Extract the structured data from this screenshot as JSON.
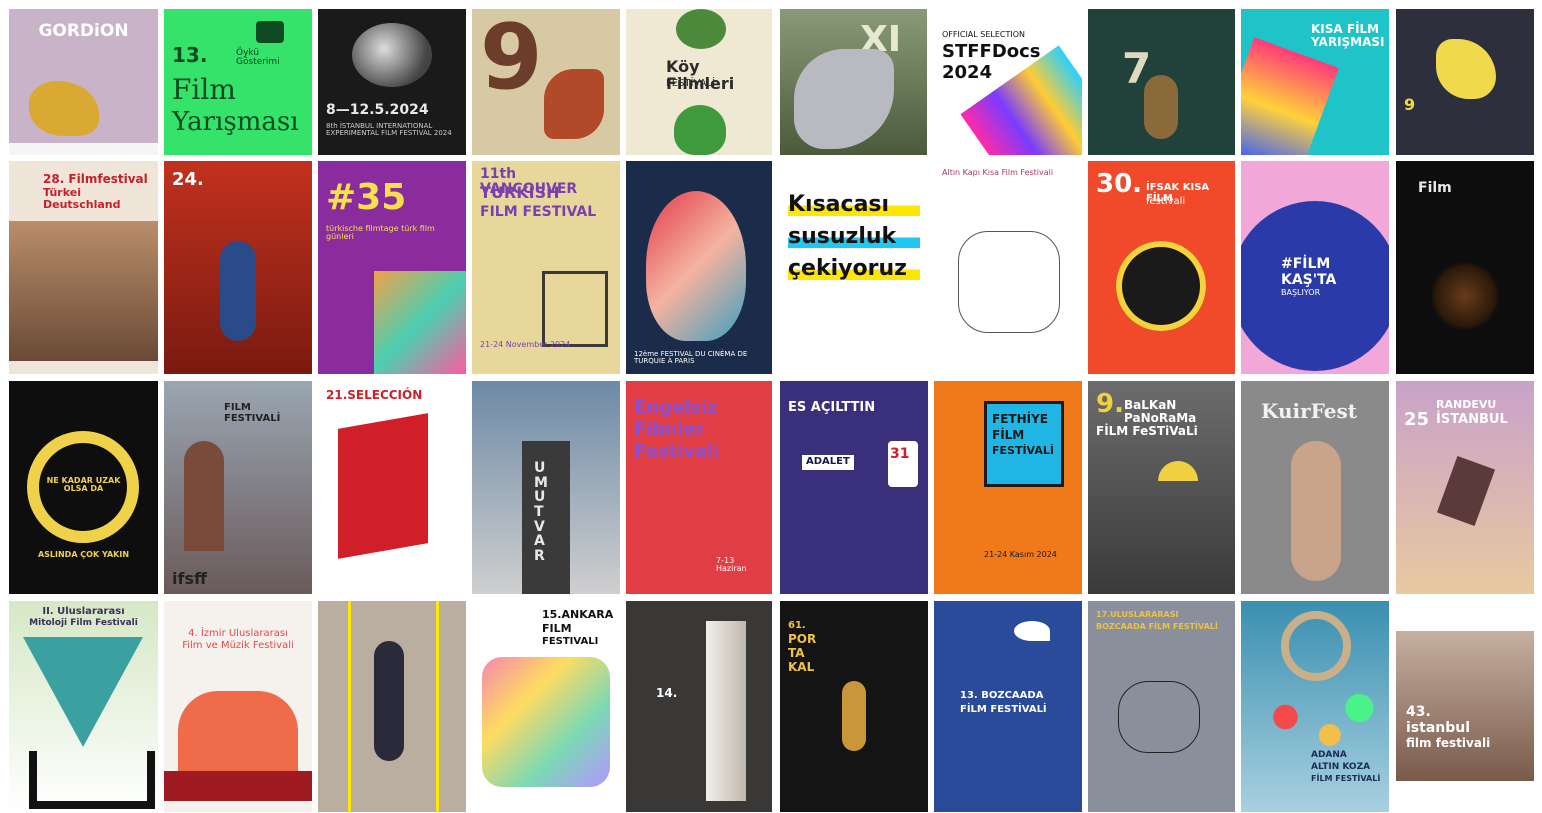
{
  "posters": {
    "r1": [
      {
        "title": "GORDiON",
        "bg": "#c9b3c9",
        "fg": "#ffffff"
      },
      {
        "title": "13.",
        "title2": "Film",
        "title3": "Yarışması",
        "sub": "Öykü Gösterimi",
        "bg": "#35e36a",
        "fg": "#0d4a22"
      },
      {
        "title": "8—12.5.2024",
        "sub": "8th İSTANBUL INTERNATIONAL EXPERIMENTAL FILM FESTIVAL 2024",
        "bg": "#1a1a1a",
        "fg": "#e8e8e8"
      },
      {
        "title": "9",
        "bg": "#d6c9a4",
        "fg": "#6b3d2a"
      },
      {
        "title": "Köy Filmleri",
        "title2": "FESTİVALİ",
        "bg": "#efe8d2",
        "fg": "#2b2b2b"
      },
      {
        "title": "XI",
        "bg": "#6c7b5a",
        "fg": "#e5e9d0"
      },
      {
        "title": "OFFICIAL SELECTION",
        "title2": "STFFDocs",
        "title3": "2024",
        "bg": "#ffffff",
        "fg": "#111111"
      },
      {
        "title": "7",
        "bg": "#21423a",
        "fg": "#e0d8c0"
      },
      {
        "title": "KISA FİLM YARIŞMASI",
        "bg": "#1fc4c9",
        "fg": "#ffffff"
      },
      {
        "title": "9",
        "bg": "#2d2f3d",
        "fg": "#f0d94a"
      }
    ],
    "r2": [
      {
        "title": "28. Filmfestival",
        "title2": "Türkei Deutschland",
        "bg": "#efe5d8",
        "fg": "#c8202a"
      },
      {
        "title": "24.",
        "bg": "#b8281a",
        "fg": "#ffffff"
      },
      {
        "title": "#35",
        "sub": "türkische filmtage türk film günleri",
        "bg": "#8b2c9e",
        "fg": "#f4e04a"
      },
      {
        "title": "11th VANCOUVER",
        "title2": "TURKISH",
        "title3": "FILM FESTIVAL",
        "sub": "21-24 November 2024",
        "bg": "#e8d79a",
        "fg": "#7a3fb0"
      },
      {
        "title": "12ème FESTIVAL DU CINÉMA DE TURQUIE À PARIS",
        "bg": "#1b2b4a",
        "fg": "#ffffff"
      },
      {
        "title": "Kısacası",
        "title2": "susuzluk",
        "title3": "çekiyoruz",
        "bg": "#ffffff",
        "fg": "#111111"
      },
      {
        "title": "Altın Kapı Kısa Film Festivali",
        "bg": "#ffffff",
        "fg": "#333333"
      },
      {
        "title": "30.",
        "title2": "İFSAK KISA FİLM",
        "title3": "festivali",
        "bg": "#f04a2a",
        "fg": "#ffffff"
      },
      {
        "title": "#FİLM",
        "title2": "KAŞ'TA",
        "title3": "BAŞLIYOR",
        "bg": "#f1a7d7",
        "fg": "#ffffff"
      },
      {
        "title": "Film",
        "bg": "#0d0d0d",
        "fg": "#e8e8e8"
      }
    ],
    "r3": [
      {
        "title": "NE KADAR UZAK OLSA DA",
        "title2": "ASLINDA ÇOK YAKIN",
        "bg": "#0e0e0e",
        "fg": "#f0d24a"
      },
      {
        "title": "FILM FESTIVALİ",
        "title2": "ifsff",
        "bg": "#a8b3bd",
        "fg": "#222222"
      },
      {
        "title": "21.SELECCIÓN",
        "bg": "#ffffff",
        "fg": "#d11f2a"
      },
      {
        "title": "UMUTVAR",
        "bg": "#6d8aa6",
        "fg": "#e8e8e8"
      },
      {
        "title": "Engelsiz",
        "title2": "Filmler",
        "title3": "Festivali",
        "sub": "7-13 Haziran",
        "bg": "#e03d45",
        "fg": "#8b4fd1"
      },
      {
        "title": "ES AÇILTTIN",
        "title2": "ADALET",
        "sub": "31",
        "bg": "#3a2f7a",
        "fg": "#ffffff"
      },
      {
        "title": "FETHİYE",
        "title2": "FİLM",
        "title3": "FESTİVALİ",
        "sub": "21-24 Kasım 2024",
        "bg": "#f07a1a",
        "fg": "#1a1a1a"
      },
      {
        "title": "9.",
        "title2": "BaLKaN PaNoRaMa",
        "title3": "FİLM FeSTiVaLi",
        "bg": "#6c6c6c",
        "fg": "#ffffff"
      },
      {
        "title": "KuirFest",
        "bg": "#8a8a8a",
        "fg": "#f2f2f2"
      },
      {
        "title": "RANDEVU",
        "title2": "İSTANBUL",
        "sub": "25",
        "bg": "#c9a2c9",
        "fg": "#ffffff"
      }
    ],
    "r4": [
      {
        "title": "II. Uluslararası",
        "title2": "Mitoloji Film Festivali",
        "bg": "#d5e8c5",
        "fg": "#3a2f5a"
      },
      {
        "title": "4. İzmir Uluslararası",
        "title2": "Film ve Müzik Festivali",
        "bg": "#f5f2ee",
        "fg": "#e04a4a"
      },
      {
        "title": "",
        "bg": "#b9aea0",
        "fg": "#111111"
      },
      {
        "title": "15.ANKARA",
        "title2": "FILM",
        "title3": "FESTIVALI",
        "bg": "#ffffff",
        "fg": "#111111"
      },
      {
        "title": "14.",
        "bg": "#3a3836",
        "fg": "#ffffff"
      },
      {
        "title": "61.",
        "title2": "POR",
        "title3": "TA",
        "sub": "KAL",
        "bg": "#141414",
        "fg": "#f0c14a"
      },
      {
        "title": "13. BOZCAADA",
        "title2": "FİLM FESTİVALİ",
        "bg": "#2a4a9a",
        "fg": "#ffffff"
      },
      {
        "title": "17.ULUSLARARASI",
        "title2": "BOZCAADA FİLM FESTİVALİ",
        "bg": "#8a8f9c",
        "fg": "#f0c040"
      },
      {
        "title": "ADANA",
        "title2": "ALTIN KOZA",
        "title3": "FİLM FESTİVALİ",
        "bg": "#3a8fb0",
        "fg": "#1b2b5a"
      },
      {
        "title": "43.",
        "title2": "istanbul",
        "title3": "film festivali",
        "bg": "#c6b0a0",
        "fg": "#ffffff"
      }
    ]
  },
  "accents": {
    "yellow": "#ffe600",
    "cyan": "#20c7f0",
    "red": "#d11f2a"
  }
}
